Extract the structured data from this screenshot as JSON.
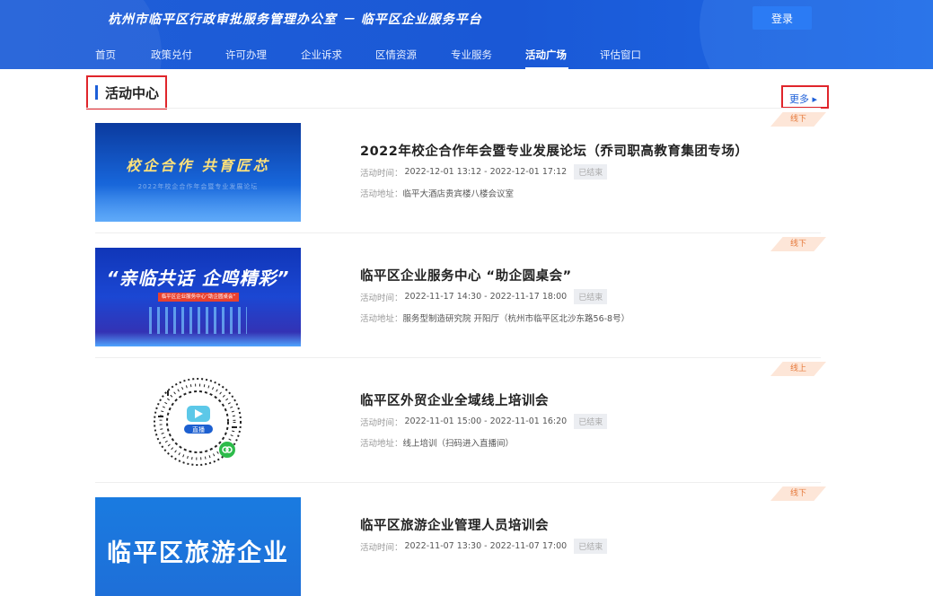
{
  "header": {
    "site_title": "杭州市临平区行政审批服务管理办公室 － 临平区企业服务平台",
    "login_label": "登录",
    "nav": [
      {
        "label": "首页",
        "active": false
      },
      {
        "label": "政策兑付",
        "active": false
      },
      {
        "label": "许可办理",
        "active": false
      },
      {
        "label": "企业诉求",
        "active": false
      },
      {
        "label": "区情资源",
        "active": false
      },
      {
        "label": "专业服务",
        "active": false
      },
      {
        "label": "活动广场",
        "active": true
      },
      {
        "label": "评估窗口",
        "active": false
      }
    ]
  },
  "section": {
    "title": "活动中心",
    "more_label": "更多 ▸"
  },
  "activities": [
    {
      "title": "2022年校企合作年会暨专业发展论坛（乔司职高教育集团专场）",
      "time_label": "活动时间：",
      "time": "2022-12-01 13:12 - 2022-12-01 17:12",
      "status": "已结束",
      "addr_label": "活动地址：",
      "addr": "临平大酒店贵宾楼八楼会议室",
      "tag": "线下",
      "thumb_text": "校企合作 共育匠芯",
      "thumb_sub": "2022年校企合作年会暨专业发展论坛"
    },
    {
      "title": "临平区企业服务中心 “助企圆桌会”",
      "time_label": "活动时间：",
      "time": "2022-11-17 14:30 - 2022-11-17 18:00",
      "status": "已结束",
      "addr_label": "活动地址：",
      "addr": "服务型制造研究院 开阳厅（杭州市临平区北沙东路56-8号）",
      "tag": "线下",
      "thumb_text": "“亲临共话 企鸣精彩”",
      "thumb_sub": "临平区企业服务中心“助企圆桌会”"
    },
    {
      "title": "临平区外贸企业全域线上培训会",
      "time_label": "活动时间：",
      "time": "2022-11-01 15:00 - 2022-11-01 16:20",
      "status": "已结束",
      "addr_label": "活动地址：",
      "addr": "线上培训（扫码进入直播间）",
      "tag": "线上",
      "thumb_text": "直播"
    },
    {
      "title": "临平区旅游企业管理人员培训会",
      "time_label": "活动时间：",
      "time": "2022-11-07 13:30 - 2022-11-07 17:00",
      "status": "已结束",
      "tag": "线下",
      "thumb_text": "临平区旅游企业"
    }
  ]
}
